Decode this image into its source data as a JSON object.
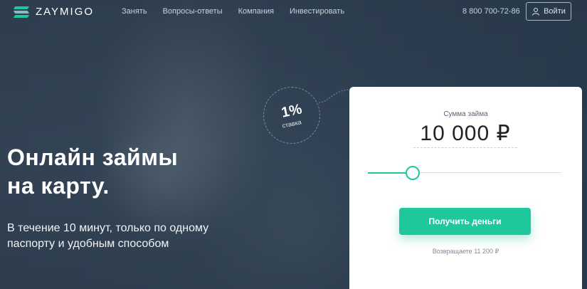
{
  "header": {
    "logo_text": "ZAYMIGO",
    "nav": [
      "Занять",
      "Вопросы-ответы",
      "Компания",
      "Инвестировать"
    ],
    "phone": "8 800 700-72-86",
    "login_label": "Войти"
  },
  "hero": {
    "headline_line1": "Онлайн займы",
    "headline_line2": "на карту.",
    "subtext_line1": "В течение 10 минут, только по одному",
    "subtext_line2": "паспорту и удобным способом"
  },
  "rate": {
    "value": "1%",
    "label": "ставка"
  },
  "loan_card": {
    "label": "Сумма займа",
    "amount": "10 000 ₽",
    "slider_level": 0.23,
    "cta_label": "Получить деньги",
    "repay_text": "Возвращаете 11 200 ₽"
  },
  "colors": {
    "accent": "#1fc79c",
    "background": "#2c3d4f"
  }
}
